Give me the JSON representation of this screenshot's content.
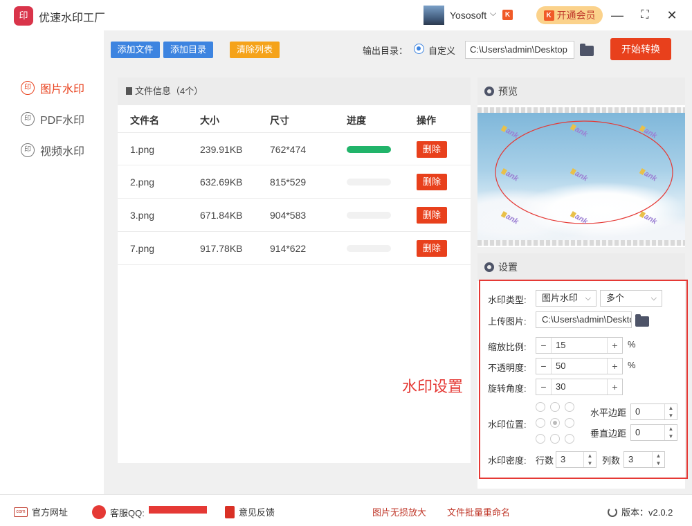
{
  "app": {
    "logo_text": "印",
    "title": "优速水印工厂",
    "username": "Yososoft",
    "vip_label": "开通会员",
    "vip_badge": "K"
  },
  "window_controls": {
    "minimize": "—",
    "maximize": "⛶",
    "close": "✕"
  },
  "sidebar": {
    "items": [
      {
        "label": "图片水印",
        "icon": "印",
        "active": true
      },
      {
        "label": "PDF水印",
        "icon": "印",
        "active": false
      },
      {
        "label": "视频水印",
        "icon": "印",
        "active": false
      }
    ]
  },
  "toolbar": {
    "add_file": "添加文件",
    "add_folder": "添加目录",
    "clear_list": "清除列表",
    "output_label": "输出目录：",
    "radio_custom": "自定义",
    "output_path": "C:\\Users\\admin\\Desktop",
    "start": "开始转换",
    "colors": {
      "blue": "#3d84e0",
      "orange": "#f5a31a",
      "red": "#e8401c"
    }
  },
  "file_panel": {
    "header": "文件信息（4个）",
    "columns": [
      "文件名",
      "大小",
      "尺寸",
      "进度",
      "操作"
    ],
    "rows": [
      {
        "name": "1.png",
        "size": "239.91KB",
        "dims": "762*474",
        "progress": 1.0,
        "action": "删除"
      },
      {
        "name": "2.png",
        "size": "632.69KB",
        "dims": "815*529",
        "progress": 0.0,
        "action": "删除"
      },
      {
        "name": "3.png",
        "size": "671.84KB",
        "dims": "904*583",
        "progress": 0.0,
        "action": "删除"
      },
      {
        "name": "7.png",
        "size": "917.78KB",
        "dims": "914*622",
        "progress": 0.0,
        "action": "删除"
      }
    ]
  },
  "preview": {
    "header": "预览",
    "watermark_text": "ank"
  },
  "settings": {
    "header": "设置",
    "type_label": "水印类型:",
    "type_value": "图片水印",
    "count_value": "多个",
    "upload_label": "上传图片:",
    "upload_path": "C:\\Users\\admin\\Desktop",
    "scale_label": "缩放比例:",
    "scale_value": "15",
    "opacity_label": "不透明度:",
    "opacity_value": "50",
    "rotate_label": "旋转角度:",
    "rotate_value": "30",
    "percent": "%",
    "position_label": "水印位置:",
    "h_margin_label": "水平边距",
    "h_margin_value": "0",
    "v_margin_label": "垂直边距",
    "v_margin_value": "0",
    "density_label": "水印密度:",
    "rows_label": "行数",
    "rows_value": "3",
    "cols_label": "列数",
    "cols_value": "3",
    "annotation": "水印设置",
    "minus": "−",
    "plus": "+"
  },
  "footer": {
    "website": "官方网址",
    "website_icon": "com",
    "qq": "客服QQ:",
    "feedback": "意见反馈",
    "enlarge": "图片无损放大",
    "rename": "文件批量重命名",
    "version": "版本：v2.0.2"
  }
}
